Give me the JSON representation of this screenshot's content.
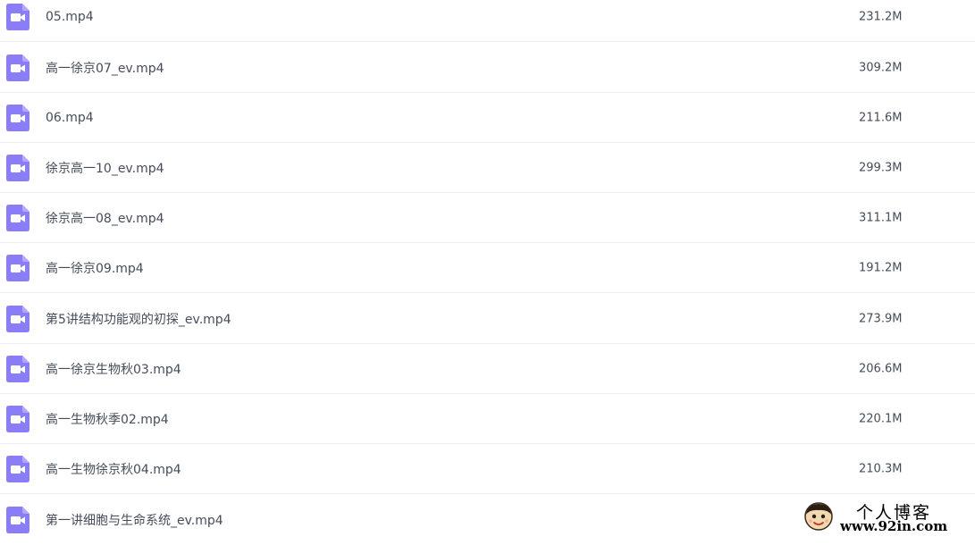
{
  "colors": {
    "icon_bg": "#8b7cf8",
    "text": "#454d5a",
    "divider": "#ededed"
  },
  "files": [
    {
      "icon": "video-file-icon",
      "name": "05.mp4",
      "size": "231.2M"
    },
    {
      "icon": "video-file-icon",
      "name": "高一徐京07_ev.mp4",
      "size": "309.2M"
    },
    {
      "icon": "video-file-icon",
      "name": "06.mp4",
      "size": "211.6M"
    },
    {
      "icon": "video-file-icon",
      "name": "徐京高一10_ev.mp4",
      "size": "299.3M"
    },
    {
      "icon": "video-file-icon",
      "name": "徐京高一08_ev.mp4",
      "size": "311.1M"
    },
    {
      "icon": "video-file-icon",
      "name": "高一徐京09.mp4",
      "size": "191.2M"
    },
    {
      "icon": "video-file-icon",
      "name": "第5讲结构功能观的初探_ev.mp4",
      "size": "273.9M"
    },
    {
      "icon": "video-file-icon",
      "name": "高一徐京生物秋03.mp4",
      "size": "206.6M"
    },
    {
      "icon": "video-file-icon",
      "name": "高一生物秋季02.mp4",
      "size": "220.1M"
    },
    {
      "icon": "video-file-icon",
      "name": "高一生物徐京秋04.mp4",
      "size": "210.3M"
    },
    {
      "icon": "video-file-icon",
      "name": "第一讲细胞与生命系统_ev.mp4",
      "size": ""
    }
  ],
  "watermark": {
    "title": "个人博客",
    "url": "www.92in.com"
  }
}
